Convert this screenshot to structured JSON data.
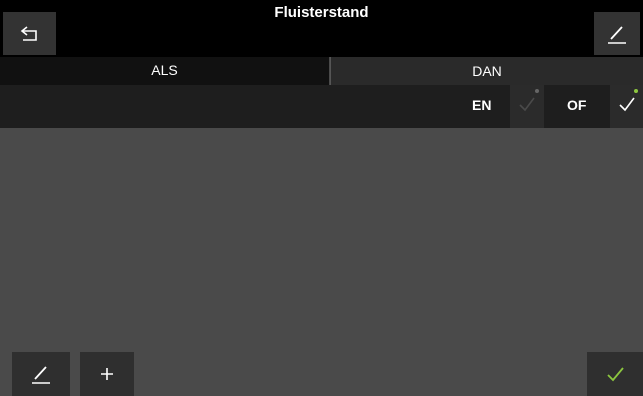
{
  "header": {
    "title": "Fluisterstand",
    "back_icon": "back-arrow-icon",
    "edit_icon": "pencil-icon"
  },
  "tabs": [
    {
      "label": "ALS",
      "active": true
    },
    {
      "label": "DAN",
      "active": false
    }
  ],
  "logic": {
    "and_label": "EN",
    "or_label": "OF",
    "and_checked": false,
    "or_checked": true
  },
  "footer": {
    "edit_icon": "pencil-icon",
    "add_icon": "plus-icon",
    "confirm_icon": "check-icon"
  },
  "colors": {
    "accent": "#8cc63f",
    "background": "#4a4a4a",
    "bar": "#000000"
  }
}
